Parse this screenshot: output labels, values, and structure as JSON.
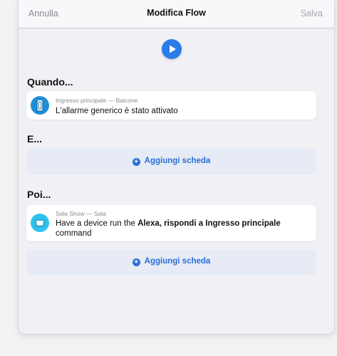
{
  "header": {
    "cancel_label": "Annulla",
    "title": "Modifica Flow",
    "save_label": "Salva"
  },
  "sections": {
    "when": {
      "title": "Quando..."
    },
    "and": {
      "title": "E..."
    },
    "then": {
      "title": "Poi..."
    }
  },
  "when_card": {
    "icon": "door-sensor-icon",
    "device": "Ingresso principale — Balcone",
    "text": "L'allarme generico è stato attivato"
  },
  "then_card": {
    "icon": "echo-show-icon",
    "device": "Sala Show — Sala",
    "text_prefix": "Have a device run the ",
    "text_bold": "Alexa, rispondi a Ingresso principale",
    "text_suffix": " command"
  },
  "add_card_label": "Aggiungi scheda",
  "colors": {
    "accent": "#2a7de8",
    "link": "#2a6fd6",
    "add_bg": "#e6ebf5"
  }
}
